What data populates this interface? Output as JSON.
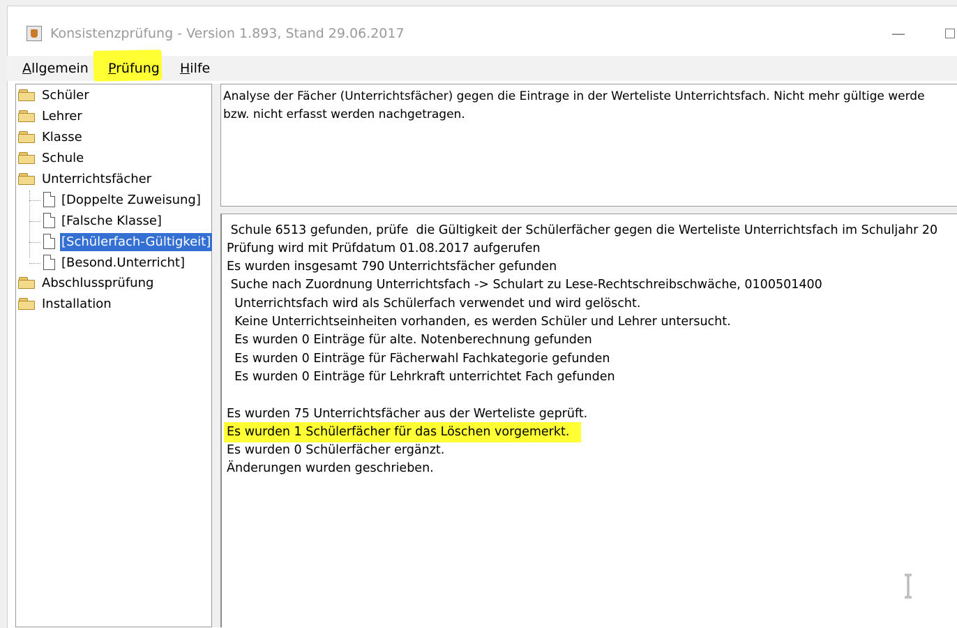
{
  "window": {
    "title": "Konsistenzprüfung - Version 1.893, Stand 29.06.2017",
    "minimize_glyph": "—"
  },
  "menu": [
    {
      "label_ul": "A",
      "label_rest": "llgemein"
    },
    {
      "label_ul": "P",
      "label_rest": "rüfung"
    },
    {
      "label_ul": "H",
      "label_rest": "ilfe"
    }
  ],
  "tree": {
    "folders_top": [
      "Schüler",
      "Lehrer",
      "Klasse",
      "Schule",
      "Unterrichtsfächer"
    ],
    "children": [
      "[Doppelte Zuweisung]",
      "[Falsche Klasse]",
      "[Schülerfach-Gültigkeit]",
      "[Besond.Unterricht]"
    ],
    "selected_child": "[Schülerfach-Gültigkeit]",
    "folders_bottom": [
      "Abschlussprüfung",
      "Installation"
    ]
  },
  "description": {
    "lines": [
      "Analyse der Fächer (Unterrichtsfächer) gegen die Eintrage in der Werteliste Unterrichtsfach. Nicht mehr gültige werde",
      "bzw. nicht erfasst werden nachgetragen."
    ]
  },
  "log": {
    "lines": [
      " Schule 6513 gefunden, prüfe  die Gültigkeit der Schülerfächer gegen die Werteliste Unterrichtsfach im Schuljahr 20",
      "Prüfung wird mit Prüfdatum 01.08.2017 aufgerufen",
      "Es wurden insgesamt 790 Unterrichtsfächer gefunden",
      " Suche nach Zuordnung Unterrichtsfach -> Schulart zu Lese-Rechtschreibschwäche, 0100501400",
      "  Unterrichtsfach wird als Schülerfach verwendet und wird gelöscht.",
      "  Keine Unterrichtseinheiten vorhanden, es werden Schüler und Lehrer untersucht.",
      "  Es wurden 0 Einträge für alte. Notenberechnung gefunden",
      "  Es wurden 0 Einträge für Fächerwahl Fachkategorie gefunden",
      "  Es wurden 0 Einträge für Lehrkraft unterrichtet Fach gefunden",
      "",
      "Es wurden 75 Unterrichtsfächer aus der Werteliste geprüft.",
      "Es wurden 1 Schülerfächer für das Löschen vorgemerkt.",
      "Es wurden 0 Schülerfächer ergänzt.",
      "Änderungen wurden geschrieben."
    ],
    "highlighted_index": 11
  },
  "colors": {
    "highlight": "#ffff33",
    "selection": "#3470d4"
  },
  "icons": [
    "java-app-icon",
    "folder-icon",
    "document-icon",
    "text-cursor-icon"
  ]
}
